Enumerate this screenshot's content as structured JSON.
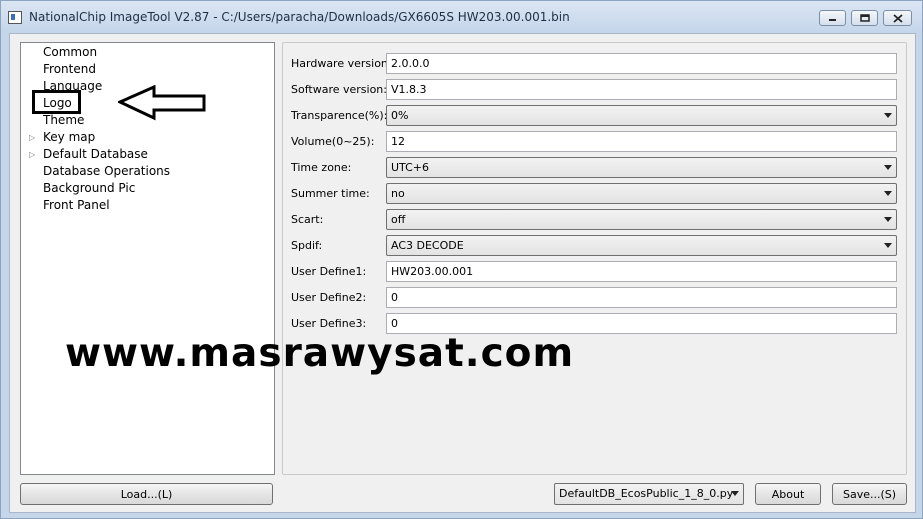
{
  "window": {
    "title": "NationalChip ImageTool V2.87 - C:/Users/paracha/Downloads/GX6605S HW203.00.001.bin"
  },
  "tree": {
    "items": [
      {
        "label": "Common",
        "expandable": false
      },
      {
        "label": "Frontend",
        "expandable": false
      },
      {
        "label": "Language",
        "expandable": false
      },
      {
        "label": "Logo",
        "expandable": false
      },
      {
        "label": "Theme",
        "expandable": false
      },
      {
        "label": "Key map",
        "expandable": true
      },
      {
        "label": "Default Database",
        "expandable": true
      },
      {
        "label": "Database Operations",
        "expandable": false
      },
      {
        "label": "Background Pic",
        "expandable": false
      },
      {
        "label": "Front Panel",
        "expandable": false
      }
    ],
    "expander_glyph": "▷"
  },
  "form": {
    "rows": [
      {
        "label": "Hardware version:",
        "type": "input",
        "value": "2.0.0.0"
      },
      {
        "label": "Software version:",
        "type": "input",
        "value": "V1.8.3"
      },
      {
        "label": "Transparence(%):",
        "type": "select",
        "value": "0%"
      },
      {
        "label": "Volume(0~25):",
        "type": "input",
        "value": "12"
      },
      {
        "label": "Time zone:",
        "type": "select",
        "value": "UTC+6"
      },
      {
        "label": "Summer time:",
        "type": "select",
        "value": "no"
      },
      {
        "label": "Scart:",
        "type": "select",
        "value": "off"
      },
      {
        "label": "Spdif:",
        "type": "select",
        "value": "AC3 DECODE"
      },
      {
        "label": "User Define1:",
        "type": "input",
        "value": "HW203.00.001"
      },
      {
        "label": "User Define2:",
        "type": "input",
        "value": "0"
      },
      {
        "label": "User Define3:",
        "type": "input",
        "value": "0"
      }
    ]
  },
  "watermark": "www.masrawysat.com",
  "footer": {
    "load_label": "Load...(L)",
    "db_select_value": "DefaultDB_EcosPublic_1_8_0.py",
    "about_label": "About",
    "save_label": "Save...(S)"
  },
  "icons": {
    "minimize": "minimize-icon",
    "maximize": "maximize-icon",
    "close": "close-icon",
    "dropdown": "chevron-down-icon"
  }
}
